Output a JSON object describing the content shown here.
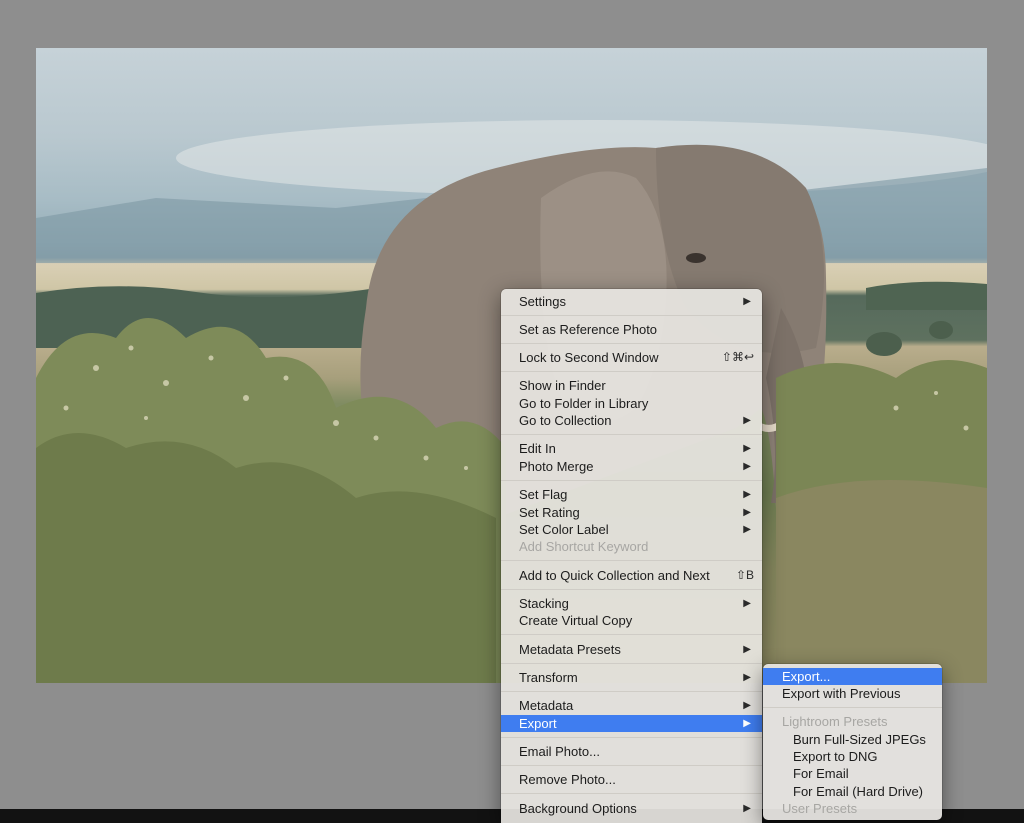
{
  "photo": {
    "subject": "elephant-photo"
  },
  "context_menu": {
    "items": [
      {
        "label": "Settings",
        "submenu": true
      },
      {
        "label": "Set as Reference Photo"
      },
      {
        "label": "Lock to Second Window",
        "shortcut": "⇧⌘↩"
      },
      {
        "label": "Show in Finder"
      },
      {
        "label": "Go to Folder in Library"
      },
      {
        "label": "Go to Collection",
        "submenu": true
      },
      {
        "label": "Edit In",
        "submenu": true
      },
      {
        "label": "Photo Merge",
        "submenu": true
      },
      {
        "label": "Set Flag",
        "submenu": true
      },
      {
        "label": "Set Rating",
        "submenu": true
      },
      {
        "label": "Set Color Label",
        "submenu": true
      },
      {
        "label": "Add Shortcut Keyword",
        "disabled": true
      },
      {
        "label": "Add to Quick Collection and Next",
        "shortcut": "⇧B"
      },
      {
        "label": "Stacking",
        "submenu": true
      },
      {
        "label": "Create Virtual Copy"
      },
      {
        "label": "Metadata Presets",
        "submenu": true
      },
      {
        "label": "Transform",
        "submenu": true
      },
      {
        "label": "Metadata",
        "submenu": true
      },
      {
        "label": "Export",
        "submenu": true,
        "active": true
      },
      {
        "label": "Email Photo..."
      },
      {
        "label": "Remove Photo..."
      },
      {
        "label": "Background Options",
        "submenu": true
      }
    ],
    "arrow_glyph": "▶"
  },
  "export_submenu": {
    "items": [
      {
        "label": "Export...",
        "active": true
      },
      {
        "label": "Export with Previous"
      },
      {
        "label": "Lightroom Presets",
        "disabled": true
      },
      {
        "label": "Burn Full-Sized JPEGs"
      },
      {
        "label": "Export to DNG"
      },
      {
        "label": "For Email"
      },
      {
        "label": "For Email (Hard Drive)"
      },
      {
        "label": "User Presets",
        "disabled": true
      }
    ]
  },
  "colors": {
    "highlight": "#3f7df0",
    "menu_bg": "#e8e6e2",
    "backdrop": "#8e8e8e"
  }
}
